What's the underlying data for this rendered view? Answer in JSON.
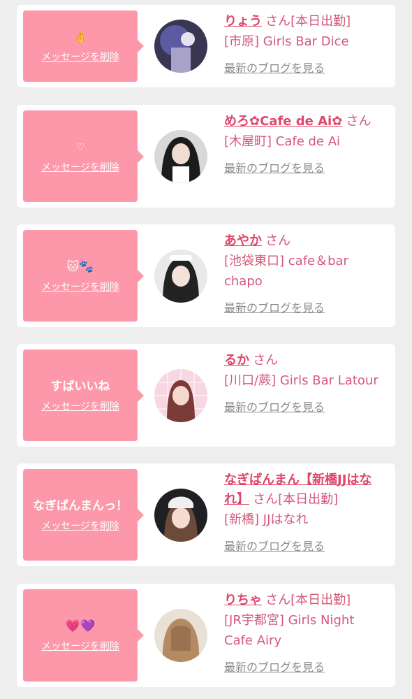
{
  "cards": [
    {
      "message": "",
      "emoji": "👌",
      "delete_label": "メッセージを削除",
      "name": "りょう",
      "san": "さん",
      "status": "[本日出勤]",
      "shop": "[市原] Girls Bar Dice",
      "blog_label": "最新のブログを見る"
    },
    {
      "message": "",
      "emoji": "♡",
      "delete_label": "メッセージを削除",
      "name": "めろ✿Cafe de Ai✿",
      "san": "さん",
      "status": "",
      "shop": "[木屋町] Cafe de Ai",
      "blog_label": "最新のブログを見る"
    },
    {
      "message": "",
      "emoji": "🐱🐾",
      "delete_label": "メッセージを削除",
      "name": "あやか",
      "san": "さん",
      "status": "",
      "shop": "[池袋東口] cafe＆bar chapo",
      "blog_label": "最新のブログを見る"
    },
    {
      "message": "すばいいね",
      "emoji": "",
      "delete_label": "メッセージを削除",
      "name": "るか",
      "san": "さん",
      "status": "",
      "shop": "[川口/蕨] Girls Bar Latour",
      "blog_label": "最新のブログを見る"
    },
    {
      "message": "なぎぱんまんっ！",
      "emoji": "",
      "delete_label": "メッセージを削除",
      "name": "なぎぱんまん【新橋JJはなれ】",
      "san": "さん",
      "status": "[本日出勤]",
      "shop": "[新橋] JJはなれ",
      "blog_label": "最新のブログを見る"
    },
    {
      "message": "",
      "emoji": "💗💜",
      "delete_label": "メッセージを削除",
      "name": "りちゃ",
      "san": "さん",
      "status": "[本日出勤]",
      "shop": "[JR宇都宮] Girls Night Cafe Airy",
      "blog_label": "最新のブログを見る"
    }
  ],
  "colors": {
    "bubble": "#fc98a9",
    "name": "#e0456b",
    "shop": "#d4587a",
    "blog": "#8a8a8a",
    "page_bg": "#eeeeee"
  }
}
